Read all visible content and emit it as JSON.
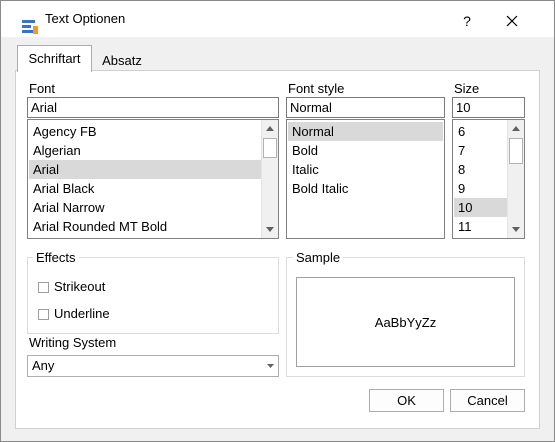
{
  "window": {
    "title": "Text Optionen",
    "help_label": "?"
  },
  "tabs": [
    {
      "label": "Schriftart",
      "active": true
    },
    {
      "label": "Absatz",
      "active": false
    }
  ],
  "font": {
    "label": "Font",
    "value": "Arial",
    "items": [
      "Agency FB",
      "Algerian",
      "Arial",
      "Arial Black",
      "Arial Narrow",
      "Arial Rounded MT Bold"
    ],
    "selected": "Arial"
  },
  "style": {
    "label": "Font style",
    "value": "Normal",
    "items": [
      "Normal",
      "Bold",
      "Italic",
      "Bold Italic"
    ],
    "selected": "Normal"
  },
  "size": {
    "label": "Size",
    "value": "10",
    "items": [
      "6",
      "7",
      "8",
      "9",
      "10",
      "11"
    ],
    "selected": "10"
  },
  "effects": {
    "label": "Effects",
    "strikeout": "Strikeout",
    "underline": "Underline",
    "strikeout_checked": false,
    "underline_checked": false
  },
  "writing_system": {
    "label": "Writing System",
    "value": "Any"
  },
  "sample": {
    "label": "Sample",
    "text": "AaBbYyZz"
  },
  "buttons": {
    "ok": "OK",
    "cancel": "Cancel"
  },
  "colors": {
    "selection": "#d9d9d9",
    "panel": "#ffffff",
    "dialog": "#f0f0f0"
  }
}
